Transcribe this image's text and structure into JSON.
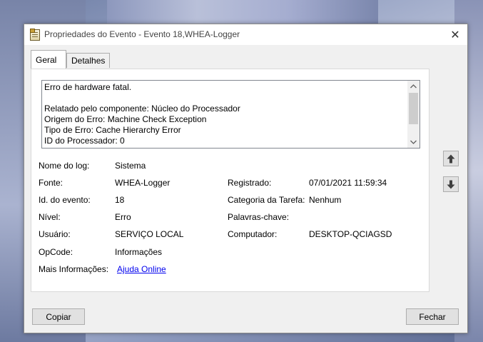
{
  "window": {
    "title": "Propriedades do Evento - Evento 18,WHEA-Logger",
    "close_symbol": "✕"
  },
  "tabs": [
    {
      "label": "Geral",
      "active": true
    },
    {
      "label": "Detalhes",
      "active": false
    }
  ],
  "description": {
    "lines": [
      "Erro de hardware fatal.",
      "",
      "Relatado pelo componente: Núcleo do Processador",
      "Origem do Erro: Machine Check Exception",
      "Tipo de Erro: Cache Hierarchy Error",
      "ID do Processador: 0"
    ]
  },
  "fields": {
    "log_name": {
      "label": "Nome do log:",
      "value": "Sistema"
    },
    "source": {
      "label": "Fonte:",
      "value": "WHEA-Logger"
    },
    "logged": {
      "label": "Registrado:",
      "value": "07/01/2021 11:59:34"
    },
    "event_id": {
      "label": "Id. do evento:",
      "value": "18"
    },
    "task_category": {
      "label": "Categoria da Tarefa:",
      "value": "Nenhum"
    },
    "level": {
      "label": "Nível:",
      "value": "Erro"
    },
    "keywords": {
      "label": "Palavras-chave:",
      "value": ""
    },
    "user": {
      "label": "Usuário:",
      "value": "SERVIÇO LOCAL"
    },
    "computer": {
      "label": "Computador:",
      "value": "DESKTOP-QCIAGSD"
    },
    "opcode": {
      "label": "OpCode:",
      "value": "Informações"
    },
    "more_info": {
      "label": "Mais Informações:",
      "link": "Ajuda Online"
    }
  },
  "buttons": {
    "copy": "Copiar",
    "close": "Fechar"
  },
  "icons": {
    "app": "event-properties-icon",
    "nav_up": "arrow-up-icon",
    "nav_down": "arrow-down-icon"
  }
}
